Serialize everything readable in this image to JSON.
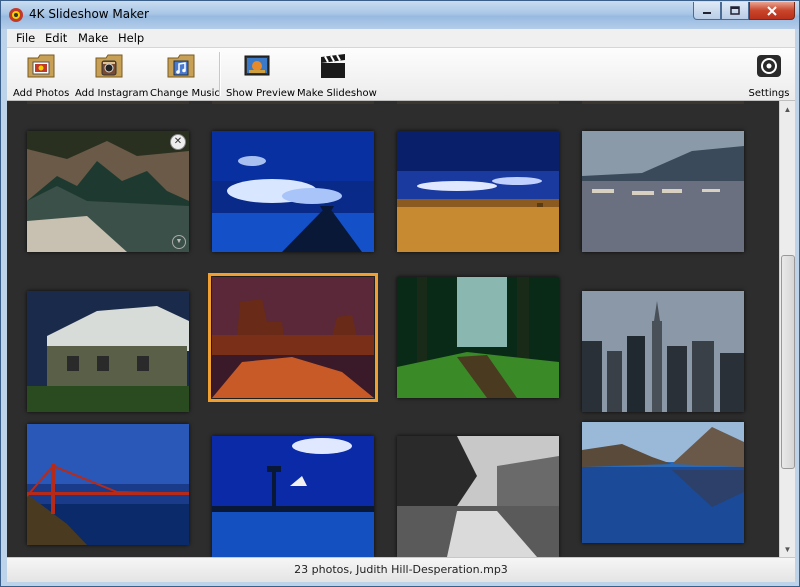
{
  "window": {
    "title": "4K Slideshow Maker"
  },
  "menu": {
    "items": [
      "File",
      "Edit",
      "Make",
      "Help"
    ]
  },
  "toolbar": {
    "add_photos": "Add Photos",
    "add_instagram": "Add Instagram",
    "change_music": "Change Music",
    "show_preview": "Show Preview",
    "make_slideshow": "Make Slideshow",
    "settings": "Settings"
  },
  "grid": {
    "photos": [
      {
        "subject": "rocky-coast-cave",
        "selected": false
      },
      {
        "subject": "pier-blue-dusk",
        "selected": false
      },
      {
        "subject": "golden-field-sky",
        "selected": false
      },
      {
        "subject": "boats-lake-mountains",
        "selected": false
      },
      {
        "subject": "wooden-house",
        "selected": false
      },
      {
        "subject": "desert-buttes",
        "selected": true
      },
      {
        "subject": "forest-path",
        "selected": false
      },
      {
        "subject": "city-skyline",
        "selected": false
      },
      {
        "subject": "golden-gate-bridge",
        "selected": false
      },
      {
        "subject": "harbor-tower-bird",
        "selected": false
      },
      {
        "subject": "bw-trees-path",
        "selected": false
      },
      {
        "subject": "mountain-lake-reflection",
        "selected": false
      }
    ]
  },
  "statusbar": {
    "text": "23 photos, Judith Hill-Desperation.mp3"
  },
  "colors": {
    "selection": "#f0a030",
    "grid_bg": "#2d2d2d"
  }
}
